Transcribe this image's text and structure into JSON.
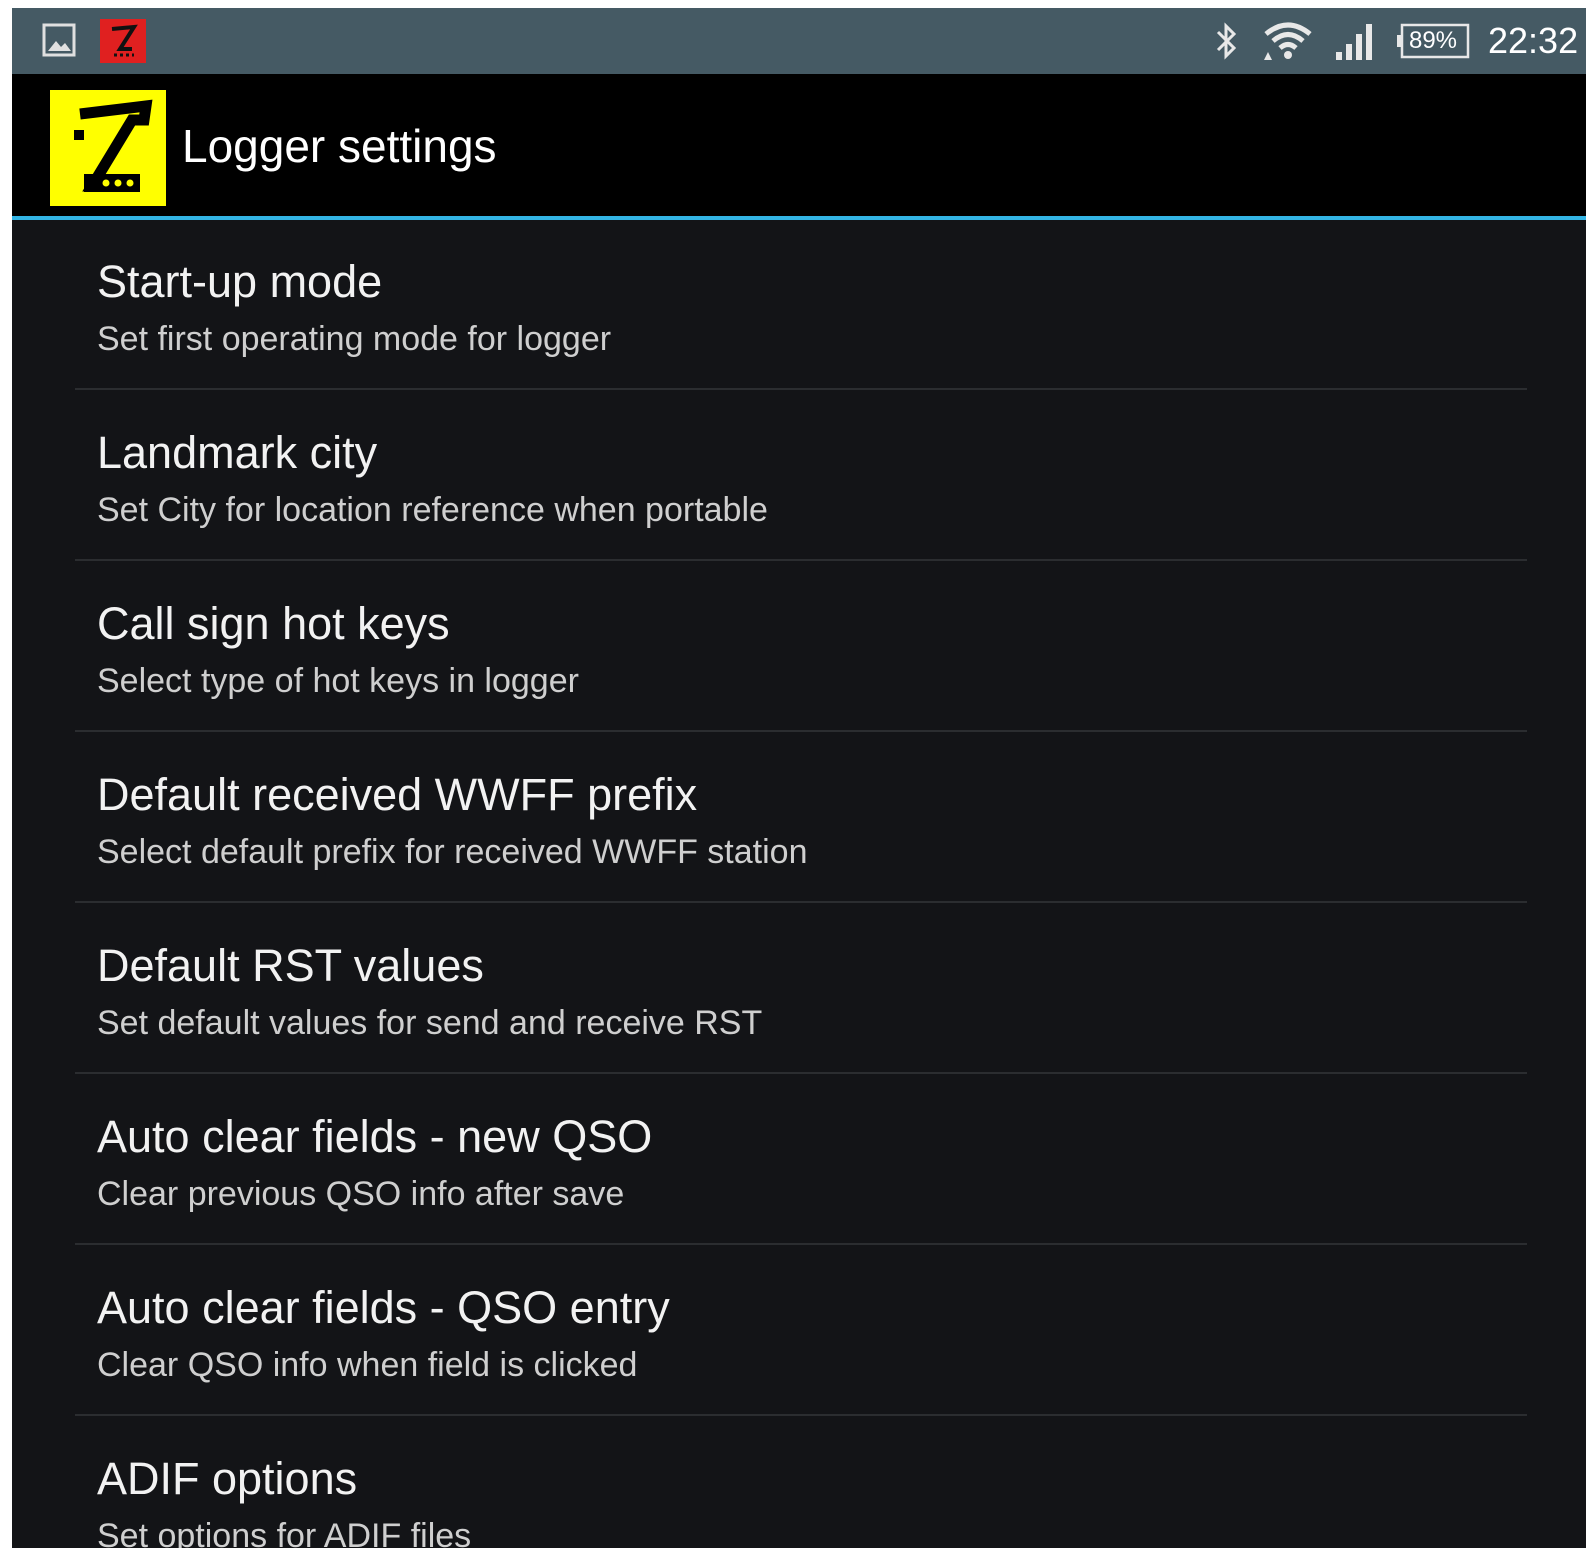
{
  "status_bar": {
    "battery_label": "89%",
    "time": "22:32",
    "icons": [
      "gallery-icon",
      "app-notification-icon",
      "bluetooth-icon",
      "wifi-icon",
      "signal-icon",
      "battery-icon"
    ]
  },
  "action_bar": {
    "title": "Logger settings",
    "logo_icon": "app-logo-icon",
    "logo_color": "#ffff00",
    "divider_color": "#33b5e5"
  },
  "preferences": [
    {
      "title": "Start-up mode",
      "summary": "Set first operating mode for logger"
    },
    {
      "title": "Landmark city",
      "summary": "Set City for location reference when portable"
    },
    {
      "title": "Call sign hot keys",
      "summary": "Select type of hot keys in logger"
    },
    {
      "title": "Default received WWFF prefix",
      "summary": "Select default prefix for received WWFF station"
    },
    {
      "title": "Default RST values",
      "summary": "Set default values for send and receive RST"
    },
    {
      "title": "Auto clear fields - new QSO",
      "summary": "Clear previous QSO info after save"
    },
    {
      "title": "Auto clear fields - QSO entry",
      "summary": "Clear QSO info when field is clicked"
    },
    {
      "title": "ADIF options",
      "summary": "Set options for ADIF files"
    }
  ]
}
